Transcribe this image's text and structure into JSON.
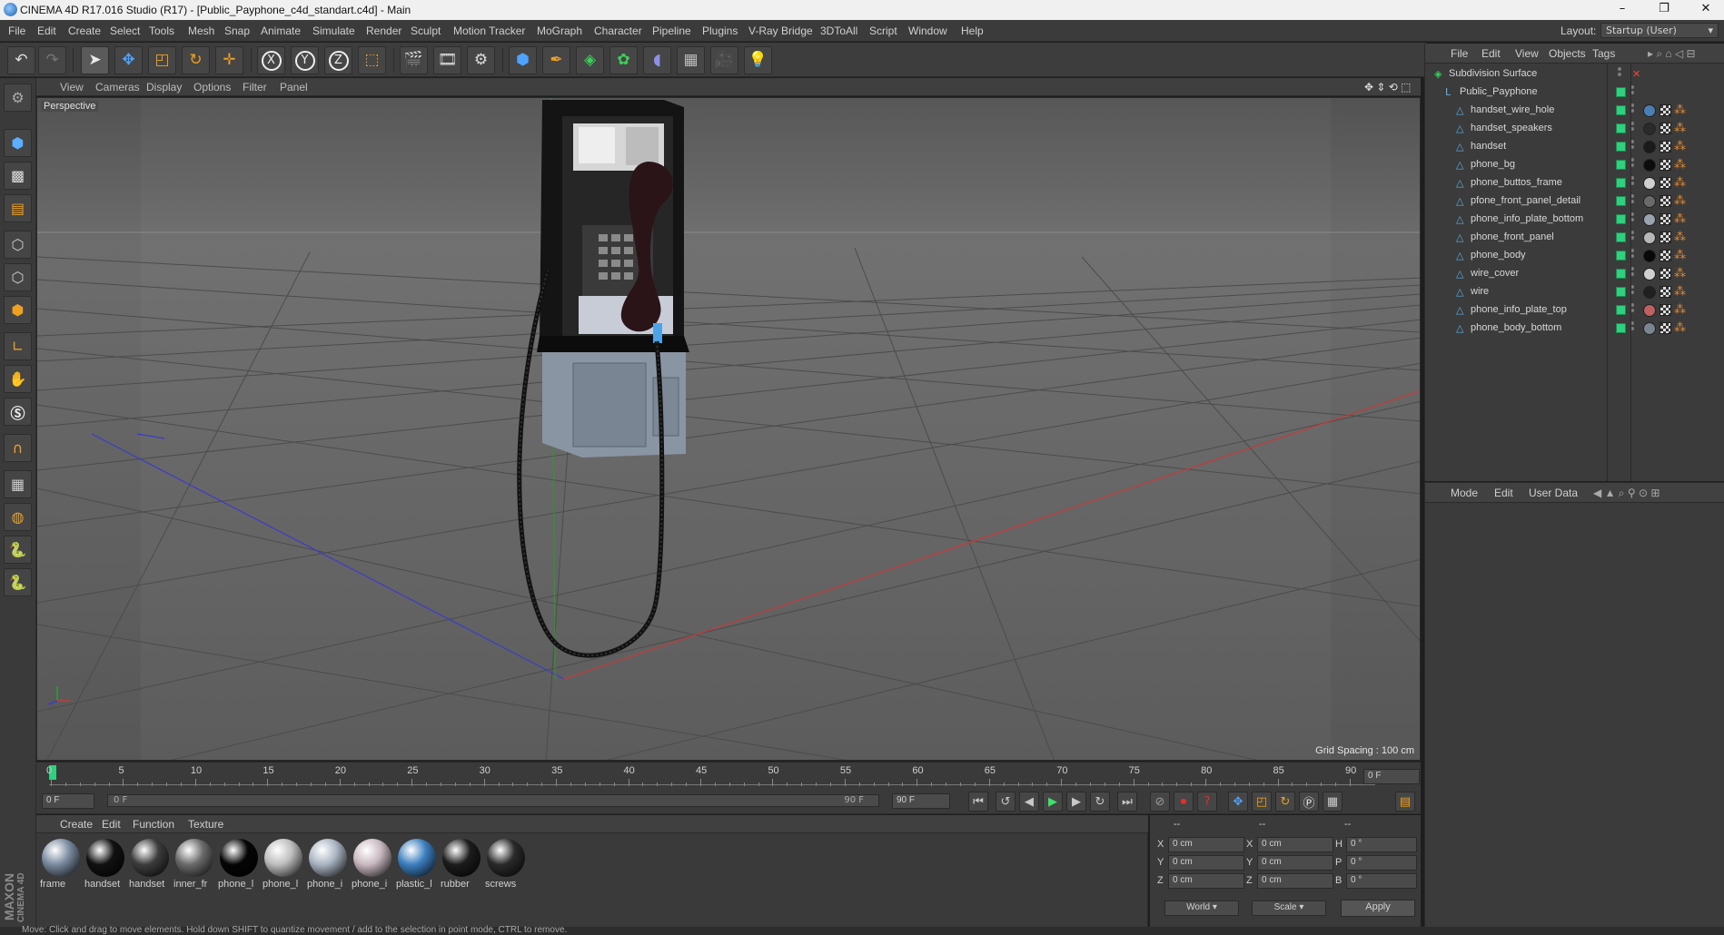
{
  "window": {
    "title": "CINEMA 4D R17.016 Studio (R17) - [Public_Payphone_c4d_standart.c4d] - Main",
    "controls": [
      "–",
      "❐",
      "✕"
    ]
  },
  "menubar": {
    "items": [
      "File",
      "Edit",
      "Create",
      "Select",
      "Tools",
      "Mesh",
      "Snap",
      "Animate",
      "Simulate",
      "Render",
      "Sculpt",
      "Motion Tracker",
      "MoGraph",
      "Character",
      "Pipeline",
      "Plugins",
      "V-Ray Bridge",
      "3DToAll",
      "Script",
      "Window",
      "Help"
    ],
    "layout_label": "Layout:",
    "layout_value": "Startup (User)"
  },
  "viewport": {
    "menu": [
      "View",
      "Cameras",
      "Display",
      "Options",
      "Filter",
      "Panel"
    ],
    "camera_label": "Perspective",
    "grid_spacing": "Grid Spacing : 100 cm"
  },
  "object_manager": {
    "menu": [
      "File",
      "Edit",
      "View",
      "Objects",
      "Tags"
    ],
    "objects": [
      {
        "name": "Subdivision Surface",
        "level": 0,
        "icon": "subdivision-icon"
      },
      {
        "name": "Public_Payphone",
        "level": 1,
        "icon": "null-icon"
      },
      {
        "name": "handset_wire_hole",
        "level": 2,
        "icon": "polygon-icon",
        "mat": "#4a7fb5"
      },
      {
        "name": "handset_speakers",
        "level": 2,
        "icon": "polygon-icon",
        "mat": "#2a2a2a"
      },
      {
        "name": "handset",
        "level": 2,
        "icon": "polygon-icon",
        "mat": "#1a1a1a"
      },
      {
        "name": "phone_bg",
        "level": 2,
        "icon": "polygon-icon",
        "mat": "#0c0c0c"
      },
      {
        "name": "phone_buttos_frame",
        "level": 2,
        "icon": "polygon-icon",
        "mat": "#cfcfcf"
      },
      {
        "name": "pfone_front_panel_detail",
        "level": 2,
        "icon": "polygon-icon",
        "mat": "#6a6a6a"
      },
      {
        "name": "phone_info_plate_bottom",
        "level": 2,
        "icon": "polygon-icon",
        "mat": "#9aa4b0"
      },
      {
        "name": "phone_front_panel",
        "level": 2,
        "icon": "polygon-icon",
        "mat": "#b8b8b8"
      },
      {
        "name": "phone_body",
        "level": 2,
        "icon": "polygon-icon",
        "mat": "#080808"
      },
      {
        "name": "wire_cover",
        "level": 2,
        "icon": "polygon-icon",
        "mat": "#d0d0d0"
      },
      {
        "name": "wire",
        "level": 2,
        "icon": "polygon-icon",
        "mat": "#202020"
      },
      {
        "name": "phone_info_plate_top",
        "level": 2,
        "icon": "polygon-icon",
        "mat": "#c06060"
      },
      {
        "name": "phone_body_bottom",
        "level": 2,
        "icon": "polygon-icon",
        "mat": "#7a8592"
      }
    ]
  },
  "attribute_manager": {
    "menu": [
      "Mode",
      "Edit",
      "User Data"
    ]
  },
  "timeline": {
    "ticks": [
      "0",
      "5",
      "10",
      "15",
      "20",
      "25",
      "30",
      "35",
      "40",
      "45",
      "50",
      "55",
      "60",
      "65",
      "70",
      "75",
      "80",
      "85",
      "90"
    ],
    "current_frame_field": "0 F",
    "start_field": "0 F",
    "range_left": "0 F",
    "range_right": "90 F",
    "end_field": "90 F"
  },
  "material_manager": {
    "menu": [
      "Create",
      "Edit",
      "Function",
      "Texture"
    ],
    "materials": [
      {
        "name": "frame",
        "color": "#7a8aa0"
      },
      {
        "name": "handset",
        "color": "#111111"
      },
      {
        "name": "handset",
        "color": "#3c3c3c"
      },
      {
        "name": "inner_fr",
        "color": "#6a6a6a"
      },
      {
        "name": "phone_l",
        "color": "#050505"
      },
      {
        "name": "phone_l",
        "color": "#bdbdbd"
      },
      {
        "name": "phone_i",
        "color": "#a9b4c2"
      },
      {
        "name": "phone_i",
        "color": "#c9b9c0"
      },
      {
        "name": "plastic_l",
        "color": "#3d7fc0"
      },
      {
        "name": "rubber",
        "color": "#1c1c1c"
      },
      {
        "name": "screws",
        "color": "#2a2a2a"
      }
    ]
  },
  "coordinates": {
    "dash1": "--",
    "dash2": "--",
    "dash3": "--",
    "rows": [
      {
        "a": "X",
        "av": "0 cm",
        "b": "X",
        "bv": "0 cm",
        "c": "H",
        "cv": "0 °"
      },
      {
        "a": "Y",
        "av": "0 cm",
        "b": "Y",
        "bv": "0 cm",
        "c": "P",
        "cv": "0 °"
      },
      {
        "a": "Z",
        "av": "0 cm",
        "b": "Z",
        "bv": "0 cm",
        "c": "B",
        "cv": "0 °"
      }
    ],
    "world": "World",
    "scale": "Scale",
    "apply": "Apply"
  },
  "status": "Move: Click and drag to move elements. Hold down SHIFT to quantize movement / add to the selection in point mode, CTRL to remove.",
  "brand": {
    "line1": "MAXON",
    "line2": "CINEMA 4D"
  }
}
